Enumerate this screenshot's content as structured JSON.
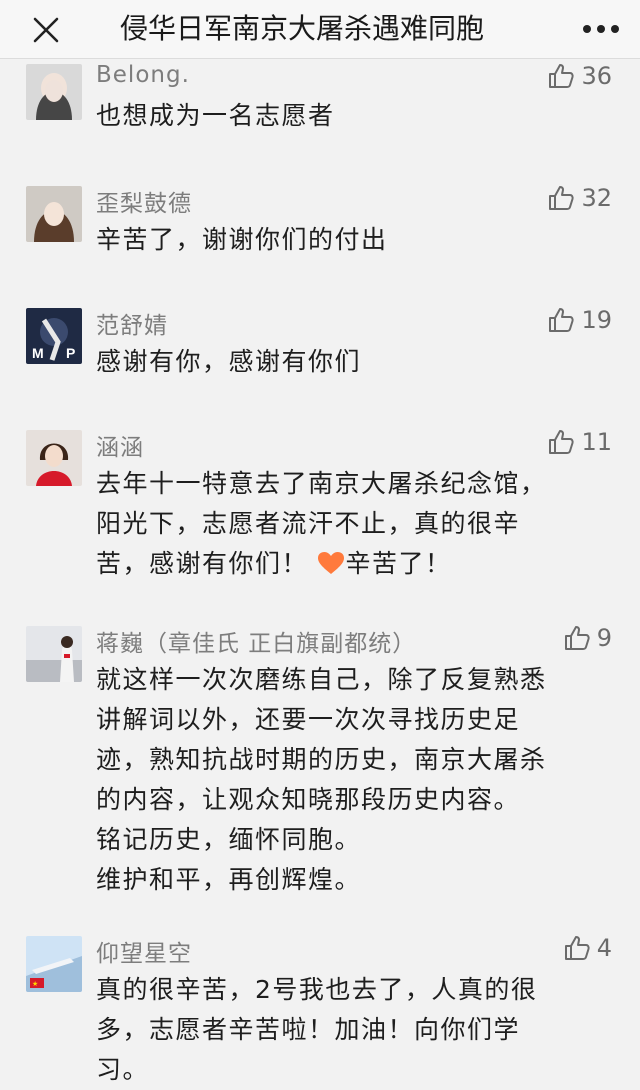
{
  "header": {
    "title": "侵华日军南京大屠杀遇难同胞",
    "close_icon": "close-icon",
    "more_icon": "more-icon"
  },
  "comments": [
    {
      "name": "Belong.",
      "likes": "36",
      "lines": [
        "也想成为一名志愿者"
      ]
    },
    {
      "name": "歪梨鼓德",
      "likes": "32",
      "lines": [
        "辛苦了，谢谢你们的付出"
      ]
    },
    {
      "name": "范舒婧",
      "likes": "19",
      "lines": [
        "感谢有你，感谢有你们"
      ]
    },
    {
      "name": "涵涵",
      "likes": "11",
      "lines": [
        "去年十一特意去了南京大屠杀纪念馆，",
        "阳光下，志愿者流汗不止，真的很辛",
        "苦，感谢有你们！",
        "辛苦了！"
      ],
      "emoji": "heart-icon"
    },
    {
      "name": "蒋巍（章佳氏 正白旗副都统）",
      "likes": "9",
      "lines": [
        "就这样一次次磨练自己，除了反复熟悉",
        "讲解词以外，还要一次次寻找历史足",
        "迹，熟知抗战时期的历史，南京大屠杀",
        "的内容，让观众知晓那段历史内容。",
        "铭记历史，缅怀同胞。",
        "维护和平，再创辉煌。"
      ]
    },
    {
      "name": "仰望星空",
      "likes": "4",
      "lines": [
        "真的很辛苦，2号我也去了，人真的很",
        "多，志愿者辛苦啦！加油！向你们学",
        "习。"
      ]
    }
  ]
}
